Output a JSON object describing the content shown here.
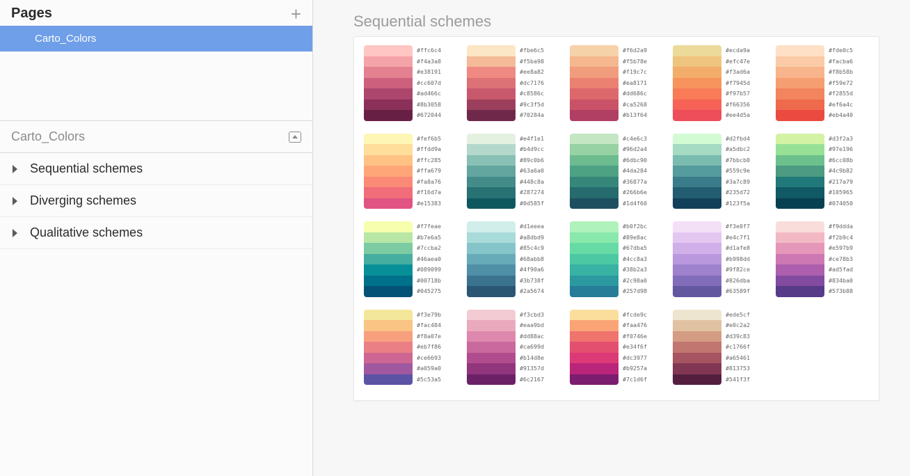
{
  "sidebar": {
    "pages_title": "Pages",
    "selected_page": "Carto_Colors",
    "layers_header": "Carto_Colors",
    "layers": [
      "Sequential schemes",
      "Diverging schemes",
      "Qualitative schemes"
    ]
  },
  "canvas": {
    "section_title": "Sequential schemes"
  },
  "schemes": [
    [
      [
        "#ffc6c4",
        "#f4a3a8",
        "#e38191",
        "#cc607d",
        "#ad466c",
        "#8b3058",
        "#672044"
      ],
      [
        "#fbe6c5",
        "#f5ba98",
        "#ee8a82",
        "#dc7176",
        "#c8586c",
        "#9c3f5d",
        "#70284a"
      ],
      [
        "#f6d2a9",
        "#f5b78e",
        "#f19c7c",
        "#ea8171",
        "#dd686c",
        "#ca5268",
        "#b13f64"
      ],
      [
        "#ecda9a",
        "#efc47e",
        "#f3ad6a",
        "#f7945d",
        "#f97b57",
        "#f66356",
        "#ee4d5a"
      ],
      [
        "#fde0c5",
        "#facba6",
        "#f8b58b",
        "#f59e72",
        "#f2855d",
        "#ef6a4c",
        "#eb4a40"
      ]
    ],
    [
      [
        "#fef6b5",
        "#ffdd9a",
        "#ffc285",
        "#ffa679",
        "#fa8a76",
        "#f16d7a",
        "#e15383"
      ],
      [
        "#e4f1e1",
        "#b4d9cc",
        "#89c0b6",
        "#63a6a0",
        "#448c8a",
        "#287274",
        "#0d585f"
      ],
      [
        "#c4e6c3",
        "#96d2a4",
        "#6dbc90",
        "#4da284",
        "#36877a",
        "#266b6e",
        "#1d4f60"
      ],
      [
        "#d2fbd4",
        "#a5dbc2",
        "#7bbcb0",
        "#559c9e",
        "#3a7c89",
        "#235d72",
        "#123f5a"
      ],
      [
        "#d3f2a3",
        "#97e196",
        "#6cc08b",
        "#4c9b82",
        "#217a79",
        "#105965",
        "#074050"
      ]
    ],
    [
      [
        "#f7feae",
        "#b7e6a5",
        "#7ccba2",
        "#46aea0",
        "#089099",
        "#00718b",
        "#045275"
      ],
      [
        "#d1eeea",
        "#a8dbd9",
        "#85c4c9",
        "#68abb8",
        "#4f90a6",
        "#3b738f",
        "#2a5674"
      ],
      [
        "#b0f2bc",
        "#89e8ac",
        "#67dba5",
        "#4cc8a3",
        "#38b2a3",
        "#2c98a0",
        "#257d98"
      ],
      [
        "#f3e0f7",
        "#e4c7f1",
        "#d1afe8",
        "#b998dd",
        "#9f82ce",
        "#826dba",
        "#63589f"
      ],
      [
        "#f9ddda",
        "#f2b9c4",
        "#e597b9",
        "#ce78b3",
        "#ad5fad",
        "#834ba0",
        "#573b88"
      ]
    ],
    [
      [
        "#f3e79b",
        "#fac484",
        "#f8a07e",
        "#eb7f86",
        "#ce6693",
        "#a059a0",
        "#5c53a5"
      ],
      [
        "#f3cbd3",
        "#eaa9bd",
        "#dd88ac",
        "#ca699d",
        "#b14d8e",
        "#91357d",
        "#6c2167"
      ],
      [
        "#fcde9c",
        "#faa476",
        "#f0746e",
        "#e34f6f",
        "#dc3977",
        "#b9257a",
        "#7c1d6f"
      ],
      [
        "#ede5cf",
        "#e0c2a2",
        "#d39c83",
        "#c1766f",
        "#a65461",
        "#813753",
        "#541f3f"
      ]
    ]
  ]
}
